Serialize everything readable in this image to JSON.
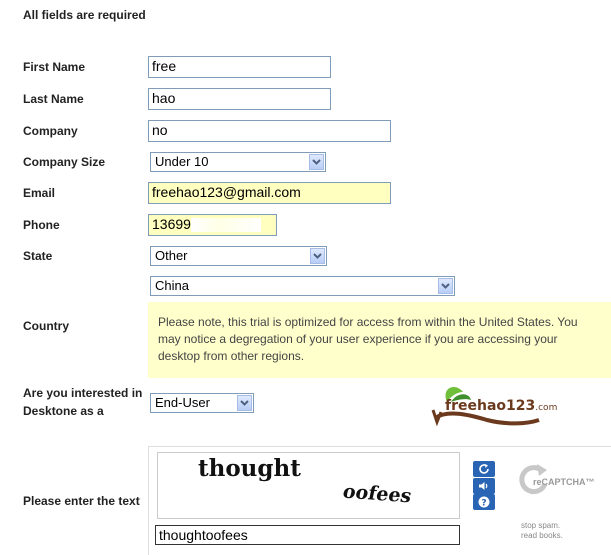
{
  "form": {
    "required_note": "All fields are required",
    "fields": {
      "first_name": {
        "label": "First Name",
        "value": "free"
      },
      "last_name": {
        "label": "Last Name",
        "value": "hao"
      },
      "company": {
        "label": "Company",
        "value": "no"
      },
      "company_size": {
        "label": "Company Size",
        "selected": "Under 10"
      },
      "email": {
        "label": "Email",
        "value": "freehao123@gmail.com"
      },
      "phone": {
        "label": "Phone",
        "value": "13699"
      },
      "state": {
        "label": "State",
        "selected": "Other"
      },
      "country": {
        "label": "Country",
        "selected": "China"
      },
      "interest": {
        "label_line1": "Are you interested in",
        "label_line2": "Desktone as a",
        "selected": "End-User"
      },
      "captcha_answer": {
        "label": "Please enter the text",
        "value": "thoughtoofees"
      }
    },
    "country_notice": "Please note, this trial is optimized for access from within the United States. You may notice a degregation of your user experience if you are accessing your desktop from other regions."
  },
  "watermark": {
    "text": "freehao123",
    "suffix": ".com"
  },
  "captcha": {
    "word1": "thought",
    "word2": "oofees",
    "brand": "reCAPTCHA™",
    "slogan_line1": "stop spam.",
    "slogan_line2": "read books.",
    "refresh_icon": "refresh-icon",
    "audio_icon": "audio-icon",
    "help_icon": "help-icon"
  },
  "colors": {
    "input_border": "#7f9db9",
    "autofill_yellow": "#ffffc0",
    "notice_bg": "#ffffcc",
    "captcha_button": "#2a64b4",
    "watermark_green": "#3f8f2e",
    "watermark_brown": "#6b3a1e"
  }
}
